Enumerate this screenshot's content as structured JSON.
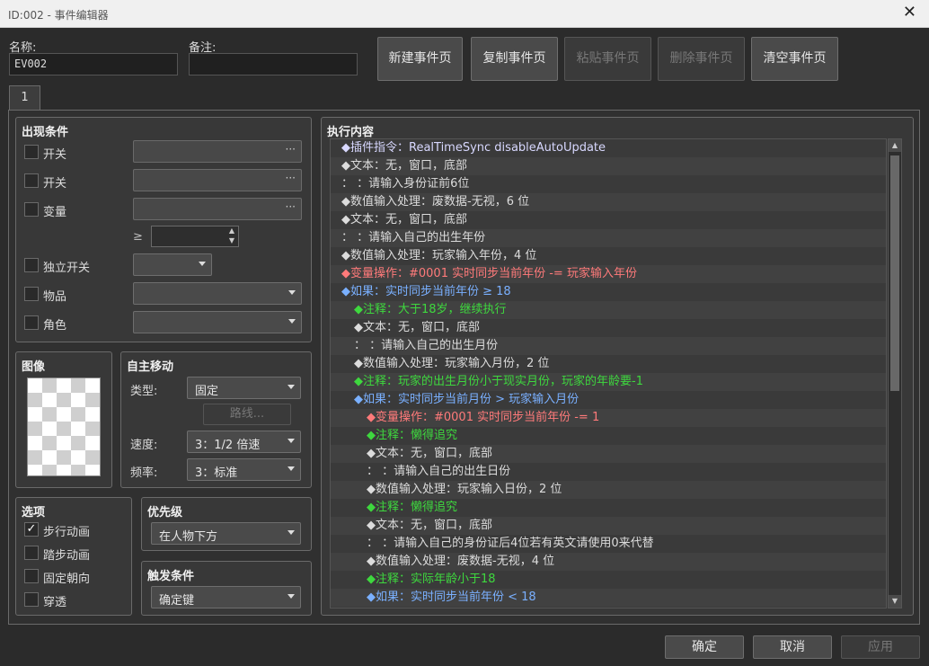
{
  "window": {
    "title": "ID:002 - 事件编辑器",
    "close_icon": "close-icon"
  },
  "name": {
    "label": "名称:",
    "value": "EV002"
  },
  "note": {
    "label": "备注:",
    "value": ""
  },
  "toolbar": {
    "new": "新建事件页",
    "copy": "复制事件页",
    "paste": "粘贴事件页",
    "delete": "删除事件页",
    "clear": "清空事件页"
  },
  "tab": {
    "label": "1"
  },
  "conditions": {
    "title": "出现条件",
    "switch1": "开关",
    "switch2": "开关",
    "variable": "变量",
    "gte": "≥",
    "self_switch": "独立开关",
    "item": "物品",
    "actor": "角色",
    "dots": "···"
  },
  "image": {
    "title": "图像"
  },
  "autonomous": {
    "title": "自主移动",
    "type_label": "类型:",
    "type_value": "固定",
    "route": "路线...",
    "speed_label": "速度:",
    "speed_value": "3：1/2 倍速",
    "freq_label": "频率:",
    "freq_value": "3：标准"
  },
  "options": {
    "title": "选项",
    "walk": "步行动画",
    "step": "踏步动画",
    "dirfix": "固定朝向",
    "through": "穿透",
    "walk_checked": true
  },
  "priority": {
    "title": "优先级",
    "value": "在人物下方"
  },
  "trigger": {
    "title": "触发条件",
    "value": "确定键"
  },
  "contents": {
    "title": "执行内容",
    "colors": {
      "white": "#dcdcdc",
      "plugin": "#d8d8ff",
      "red": "#ff7a7a",
      "blue": "#7ab0ff",
      "green": "#3ed83e",
      "text": "#dcdcdc"
    },
    "rows": [
      {
        "indent": 0,
        "color": "plugin",
        "text": "◆插件指令：RealTimeSync disableAutoUpdate"
      },
      {
        "indent": 0,
        "color": "text",
        "text": "◆文本：无，窗口，底部"
      },
      {
        "indent": 0,
        "color": "text",
        "text": "：      ：请输入身份证前6位"
      },
      {
        "indent": 0,
        "color": "text",
        "text": "◆数值输入处理：废数据-无视，6 位"
      },
      {
        "indent": 0,
        "color": "text",
        "text": "◆文本：无，窗口，底部"
      },
      {
        "indent": 0,
        "color": "text",
        "text": "：      ：请输入自己的出生年份"
      },
      {
        "indent": 0,
        "color": "text",
        "text": "◆数值输入处理：玩家输入年份，4 位"
      },
      {
        "indent": 0,
        "color": "red",
        "text": "◆变量操作：#0001 实时同步当前年份 -= 玩家输入年份"
      },
      {
        "indent": 0,
        "color": "blue",
        "text": "◆如果：实时同步当前年份 ≥ 18"
      },
      {
        "indent": 1,
        "color": "green",
        "text": "◆注释：大于18岁，继续执行"
      },
      {
        "indent": 1,
        "color": "text",
        "text": "◆文本：无，窗口，底部"
      },
      {
        "indent": 1,
        "color": "text",
        "text": "：      ：请输入自己的出生月份"
      },
      {
        "indent": 1,
        "color": "text",
        "text": "◆数值输入处理：玩家输入月份，2 位"
      },
      {
        "indent": 1,
        "color": "green",
        "text": "◆注释：玩家的出生月份小于现实月份，玩家的年龄要-1"
      },
      {
        "indent": 1,
        "color": "blue",
        "text": "◆如果：实时同步当前月份 > 玩家输入月份"
      },
      {
        "indent": 2,
        "color": "red",
        "text": "◆变量操作：#0001 实时同步当前年份 -= 1"
      },
      {
        "indent": 2,
        "color": "green",
        "text": "◆注释：懒得追究"
      },
      {
        "indent": 2,
        "color": "text",
        "text": "◆文本：无，窗口，底部"
      },
      {
        "indent": 2,
        "color": "text",
        "text": "：      ：请输入自己的出生日份"
      },
      {
        "indent": 2,
        "color": "text",
        "text": "◆数值输入处理：玩家输入日份，2 位"
      },
      {
        "indent": 2,
        "color": "green",
        "text": "◆注释：懒得追究"
      },
      {
        "indent": 2,
        "color": "text",
        "text": "◆文本：无，窗口，底部"
      },
      {
        "indent": 2,
        "color": "text",
        "text": "：      ：请输入自己的身份证后4位若有英文请使用0来代替"
      },
      {
        "indent": 2,
        "color": "text",
        "text": "◆数值输入处理：废数据-无视，4 位"
      },
      {
        "indent": 2,
        "color": "green",
        "text": "◆注释：实际年龄小于18"
      },
      {
        "indent": 2,
        "color": "blue",
        "text": "◆如果：实时同步当前年份 < 18"
      }
    ]
  },
  "footer": {
    "ok": "确定",
    "cancel": "取消",
    "apply": "应用"
  }
}
